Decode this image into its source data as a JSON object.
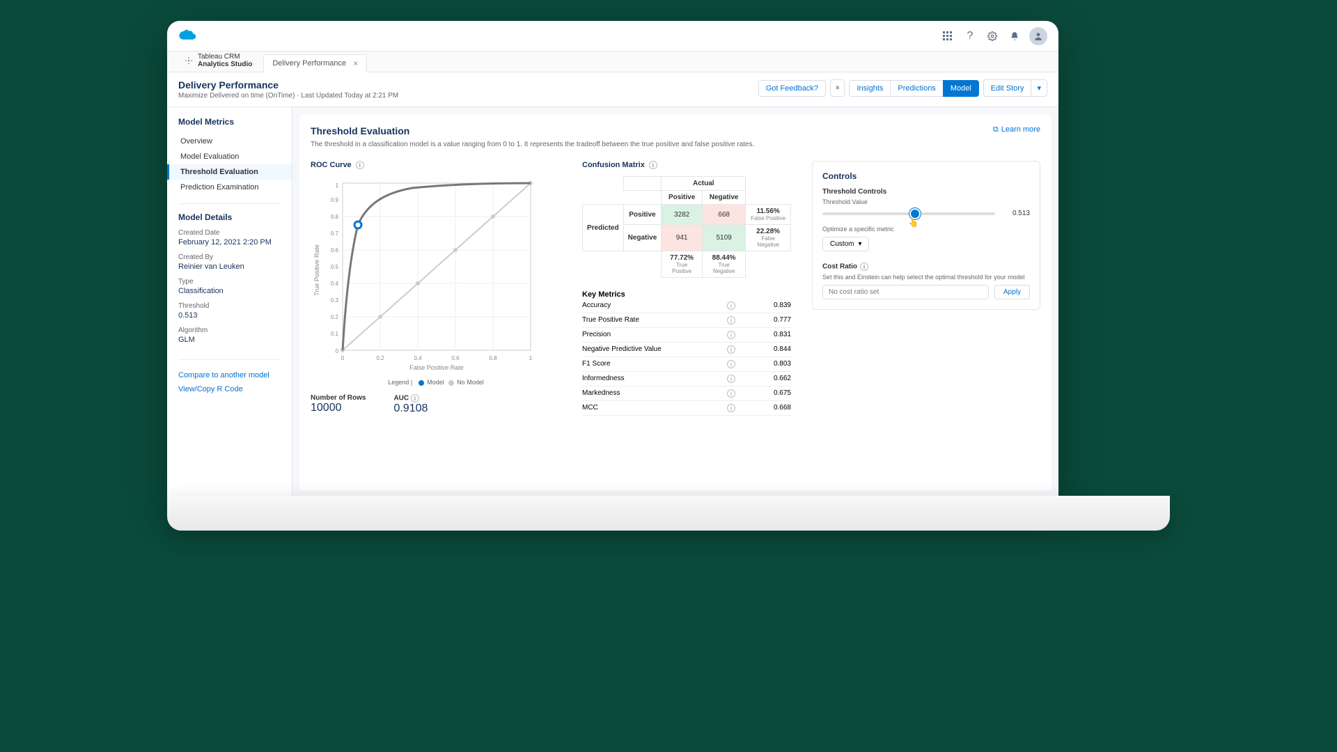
{
  "header": {
    "product_app": "Tableau CRM",
    "product_studio": "Analytics Studio",
    "tab_label": "Delivery Performance"
  },
  "titlebar": {
    "title": "Delivery Performance",
    "subtitle": "Maximize Delivered on time (OnTime) · Last Updated Today at 2:21 PM",
    "feedback": "Got Feedback?",
    "insights": "Insights",
    "predictions": "Predictions",
    "model": "Model",
    "edit_story": "Edit Story"
  },
  "sidebar": {
    "title": "Model Metrics",
    "nav": [
      "Overview",
      "Model Evaluation",
      "Threshold Evaluation",
      "Prediction Examination"
    ],
    "active_index": 2,
    "details_title": "Model Details",
    "details": [
      {
        "label": "Created Date",
        "value": "February 12, 2021 2:20 PM"
      },
      {
        "label": "Created By",
        "value": "Reinier van Leuken"
      },
      {
        "label": "Type",
        "value": "Classification"
      },
      {
        "label": "Threshold",
        "value": "0.513"
      },
      {
        "label": "Algorithm",
        "value": "GLM"
      }
    ],
    "links": [
      "Compare to another model",
      "View/Copy R Code"
    ]
  },
  "content": {
    "title": "Threshold Evaluation",
    "learn_more": "Learn more",
    "desc": "The threshold in a classification model is a value ranging from 0 to 1. It represents the tradeoff between the true positive and false positive rates.",
    "roc_title": "ROC Curve",
    "cm_title": "Confusion Matrix",
    "km_title": "Key Metrics",
    "controls_title": "Controls",
    "stats": {
      "rows_label": "Number of Rows",
      "rows": "10000",
      "auc_label": "AUC",
      "auc": "0.9108"
    },
    "legend": {
      "label": "Legend",
      "model": "Model",
      "nomodel": "No Model"
    },
    "axes": {
      "y": "True Positive Rate",
      "x": "False Positive Rate"
    }
  },
  "confusion": {
    "actual": "Actual",
    "predicted": "Predicted",
    "positive": "Positive",
    "negative": "Negative",
    "tp": "3282",
    "fn": "668",
    "fp": "941",
    "tn": "5109",
    "fpr": "11.56%",
    "fpr_lbl": "False Positive",
    "fnr": "22.28%",
    "fnr_lbl": "False Negative",
    "tpr": "77.72%",
    "tpr_lbl": "True Positive",
    "tnr": "88.44%",
    "tnr_lbl": "True Negative"
  },
  "metrics": [
    {
      "name": "Accuracy",
      "value": "0.839"
    },
    {
      "name": "True Positive Rate",
      "value": "0.777"
    },
    {
      "name": "Precision",
      "value": "0.831"
    },
    {
      "name": "Negative Predictive Value",
      "value": "0.844"
    },
    {
      "name": "F1 Score",
      "value": "0.803"
    },
    {
      "name": "Informedness",
      "value": "0.662"
    },
    {
      "name": "Markedness",
      "value": "0.675"
    },
    {
      "name": "MCC",
      "value": "0.668"
    }
  ],
  "controls": {
    "thr_title": "Threshold Controls",
    "thr_label": "Threshold Value",
    "thr_value": "0.513",
    "opt_label": "Optimize a specific metric",
    "opt_value": "Custom",
    "cost_title": "Cost Ratio",
    "cost_desc": "Set this and Einstein can help select the optimal threshold for your model",
    "cost_placeholder": "No cost ratio set",
    "apply": "Apply"
  },
  "chart_data": {
    "type": "line",
    "title": "ROC Curve",
    "xlabel": "False Positive Rate",
    "ylabel": "True Positive Rate",
    "xlim": [
      0,
      1
    ],
    "ylim": [
      0,
      1
    ],
    "series": [
      {
        "name": "Model",
        "x": [
          0,
          0.02,
          0.05,
          0.08,
          0.12,
          0.18,
          0.25,
          0.35,
          0.5,
          0.7,
          0.85,
          1.0
        ],
        "y": [
          0,
          0.35,
          0.6,
          0.75,
          0.82,
          0.88,
          0.92,
          0.95,
          0.975,
          0.99,
          0.998,
          1.0
        ]
      },
      {
        "name": "No Model",
        "x": [
          0,
          0.2,
          0.4,
          0.6,
          0.8,
          1.0
        ],
        "y": [
          0,
          0.2,
          0.4,
          0.6,
          0.8,
          1.0
        ]
      }
    ],
    "threshold_point": {
      "fpr": 0.08,
      "tpr": 0.75
    },
    "auc": 0.9108,
    "n_rows": 10000
  }
}
